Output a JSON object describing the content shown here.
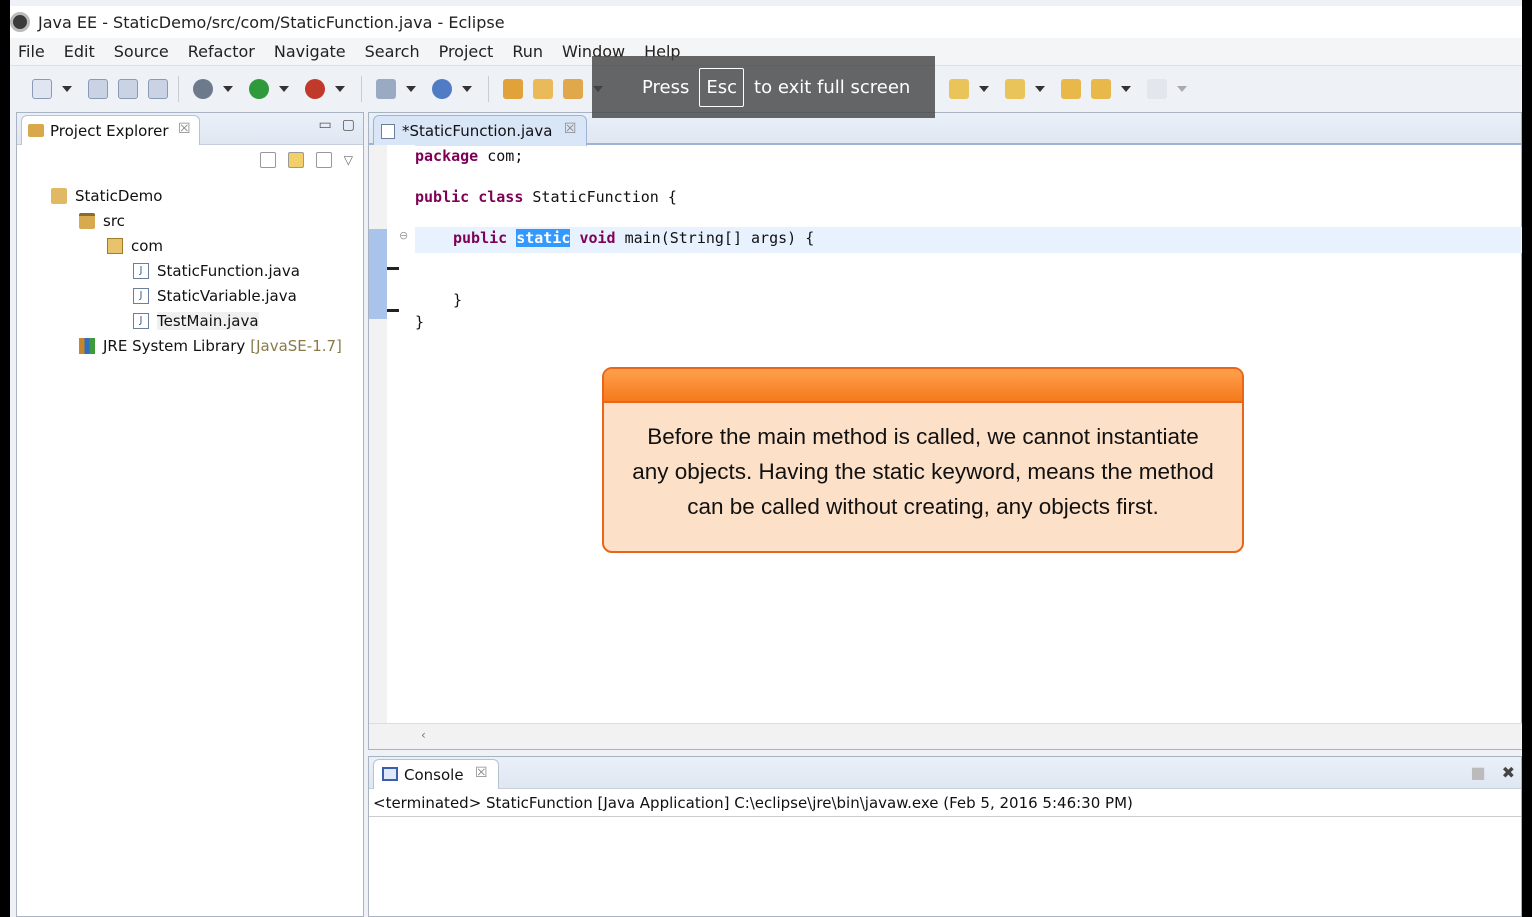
{
  "window": {
    "title": "Java EE - StaticDemo/src/com/StaticFunction.java - Eclipse"
  },
  "menu": [
    "File",
    "Edit",
    "Source",
    "Refactor",
    "Navigate",
    "Search",
    "Project",
    "Run",
    "Window",
    "Help"
  ],
  "fullscreen_notice": {
    "press": "Press",
    "key": "Esc",
    "rest": "to exit full screen"
  },
  "project_explorer": {
    "tab_label": "Project Explorer",
    "close_glyph": "☒",
    "tree": {
      "project": "StaticDemo",
      "src": "src",
      "package": "com",
      "files": [
        "StaticFunction.java",
        "StaticVariable.java",
        "TestMain.java"
      ],
      "library": "JRE System Library",
      "library_version": "[JavaSE-1.7]"
    }
  },
  "editor": {
    "tab_label": "*StaticFunction.java",
    "close_glyph": "☒",
    "code": {
      "line1_kw": "package",
      "line1_rest": " com;",
      "line2_kw1": "public",
      "line2_kw2": "class",
      "line2_rest": " StaticFunction {",
      "line3_kw1": "public",
      "line3_sel": "static",
      "line3_kw2": "void",
      "line3_rest": " main(String[] args) {",
      "line5": "}",
      "line6": "}"
    }
  },
  "callout": {
    "text": "Before the main method is called, we cannot instantiate any objects. Having the static keyword, means the method can be called without creating, any objects first."
  },
  "console": {
    "tab_label": "Console",
    "close_glyph": "☒",
    "status": "<terminated> StaticFunction [Java Application] C:\\eclipse\\jre\\bin\\javaw.exe (Feb 5, 2016 5:46:30 PM)"
  },
  "colors": {
    "accent": "#e8651a",
    "keyword": "#7f0055",
    "selection": "#3399ff"
  }
}
